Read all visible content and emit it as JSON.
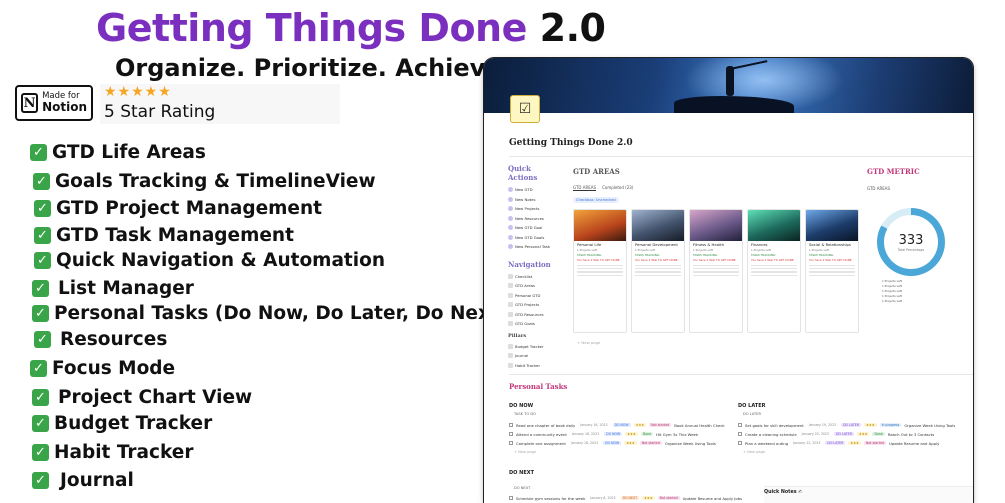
{
  "hero": {
    "title_main": "Getting Things Done",
    "title_version": "2.0",
    "subtitle": "Organize. Prioritize. Achieve"
  },
  "badge": {
    "made_for": "Made for",
    "brand": "Notion",
    "logo_letter": "N"
  },
  "rating": {
    "stars": "★★★★★",
    "label": "5 Star Rating"
  },
  "features": [
    "GTD Life Areas",
    "Goals Tracking & TimelineView",
    "GTD Project Management",
    "GTD Task Management",
    "Quick Navigation & Automation",
    "List Manager",
    "Personal Tasks (Do Now, Do Later, Do Next)",
    "Resources",
    "Focus Mode",
    "Project Chart View",
    "Budget Tracker",
    "Habit Tracker",
    "Journal"
  ],
  "check_glyph": "✓",
  "app": {
    "page_title": "Getting Things Done 2.0",
    "quick_actions": {
      "heading": "Quick Actions",
      "items": [
        "New GTD",
        "New Notes",
        "New Projects",
        "New Resources",
        "New GTD Goal",
        "New GTD Goals",
        "New Personal Task"
      ]
    },
    "navigation": {
      "heading": "Navigation",
      "items": [
        "Checklist",
        "GTD Areas",
        "Personal GTD",
        "GTD Projects",
        "GTD Resources",
        "GTD Goals"
      ]
    },
    "pillars": {
      "heading": "Pillars",
      "items": [
        "Budget Tracker",
        "Journal",
        "Habit Tracker"
      ]
    },
    "areas": {
      "heading": "GTD AREAS",
      "tabs": [
        "GTD AREAS",
        "Completed (23)"
      ],
      "filter": "Checkbox: Unchecked",
      "new_page": "+ New page",
      "cards": [
        {
          "title": "Personal Life",
          "color": "#e07b2a",
          "line1": "1 Projects Left",
          "line2": "TASKS TRACKING:",
          "line3": "You have 1 Task TO GET DONE"
        },
        {
          "title": "Personal Development",
          "color": "#3d4a66",
          "line1": "1 Projects Left",
          "line2": "TASKS TRACKING:",
          "line3": "You have 1 Task TO GET DONE"
        },
        {
          "title": "Fitness & Health",
          "color": "#6b5a8a",
          "line1": "1 Projects Left",
          "line2": "TASKS TRACKING:",
          "line3": "You have 1 Task TO GET DONE"
        },
        {
          "title": "Finances",
          "color": "#1e6b5e",
          "line1": "1 Projects Left",
          "line2": "TASKS TRACKING:",
          "line3": "You have 1 Task TO GET DONE"
        },
        {
          "title": "Social & Relationships",
          "color": "#1d3d6b",
          "line1": "1 Projects Left",
          "line2": "TASKS TRACKING:",
          "line3": "You have 1 Task TO GET DONE"
        }
      ]
    },
    "metric": {
      "heading": "GTD METRIC",
      "tab": "GTD AREAS",
      "value": "333",
      "value_label": "Total Percentage",
      "progress_fraction": 0.83,
      "legend": [
        "1 Projects Left",
        "1 Projects Left",
        "1 Projects Left",
        "1 Projects Left",
        "1 Projects Left"
      ]
    },
    "personal_tasks": {
      "heading": "Personal Tasks",
      "do_now": {
        "heading": "DO NOW",
        "sub": "TASK TO DO",
        "rows": [
          {
            "name": "Read one chapter of book daily",
            "date": "January 16, 2023",
            "tag": "DO NOW",
            "status": "Not started",
            "linked": "Book Annual Health Check"
          },
          {
            "name": "Attend a community event",
            "date": "January 18, 2023",
            "tag": "DO NOW",
            "status": "Done",
            "linked": "Hit Gym 3x This Week"
          },
          {
            "name": "Complete one assignment",
            "date": "January 18, 2023",
            "tag": "DO NOW",
            "status": "Not started",
            "linked": "Organize Week Using Tools"
          }
        ],
        "new_page": "+ New page"
      },
      "do_later": {
        "heading": "DO LATER",
        "sub": "DO LATER",
        "rows": [
          {
            "name": "Set goals for skill development",
            "date": "January 19, 2023",
            "tag": "DO LATER",
            "status": "In progress",
            "linked": "Organize Week Using Tools"
          },
          {
            "name": "Create a cleaning schedule",
            "date": "January 20, 2023",
            "tag": "DO LATER",
            "status": "Done",
            "linked": "Reach Out to 3 Contacts"
          },
          {
            "name": "Plan a weekend outing",
            "date": "January 22, 2023",
            "tag": "DO LATER",
            "status": "Not started",
            "linked": "Update Resume and Apply"
          }
        ],
        "new_page": "+ New page"
      },
      "do_next": {
        "heading": "DO NEXT",
        "sub": "DO NEXT",
        "rows": [
          {
            "name": "Schedule gym sessions for the week",
            "date": "January 8, 2023",
            "tag": "DO NEXT",
            "status": "Not started",
            "linked": "Update Resume and Apply Jobs"
          }
        ]
      },
      "quick_notes": "Quick  Notes ✍"
    }
  },
  "colors": {
    "brand_purple": "#7b2fbe",
    "check_green": "#3aa548",
    "star_gold": "#f5a623",
    "section_pink": "#c2357a",
    "gauge_blue": "#4aa7d8"
  },
  "icons": [
    "notion-logo-icon",
    "checkmark-icon",
    "star-icon",
    "page-icon",
    "gauge-chart"
  ]
}
